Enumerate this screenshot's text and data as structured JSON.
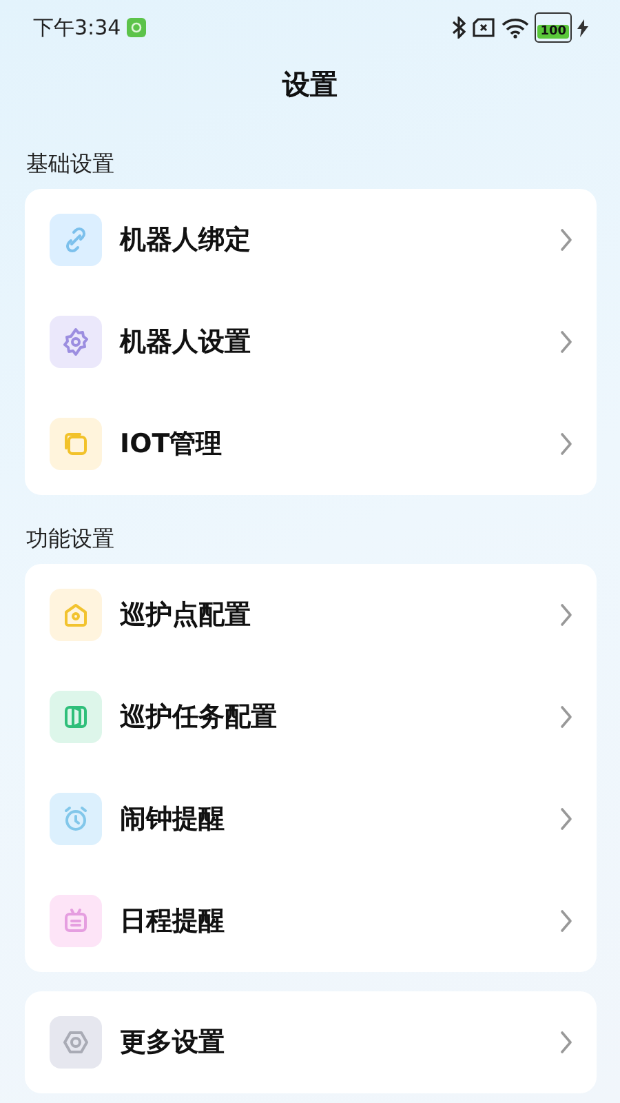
{
  "status_bar": {
    "time": "下午3:34",
    "battery": "100"
  },
  "title": "设置",
  "sections": [
    {
      "heading": "基础设置",
      "items": [
        {
          "label": "机器人绑定",
          "kind": "link"
        },
        {
          "label": "机器人设置",
          "kind": "gear"
        },
        {
          "label": "IOT管理",
          "kind": "layers"
        }
      ]
    },
    {
      "heading": "功能设置",
      "items": [
        {
          "label": "巡护点配置",
          "kind": "house"
        },
        {
          "label": "巡护任务配置",
          "kind": "door"
        },
        {
          "label": "闹钟提醒",
          "kind": "alarm"
        },
        {
          "label": "日程提醒",
          "kind": "calendar"
        }
      ]
    },
    {
      "items": [
        {
          "label": "更多设置",
          "kind": "hexagon"
        }
      ]
    }
  ]
}
